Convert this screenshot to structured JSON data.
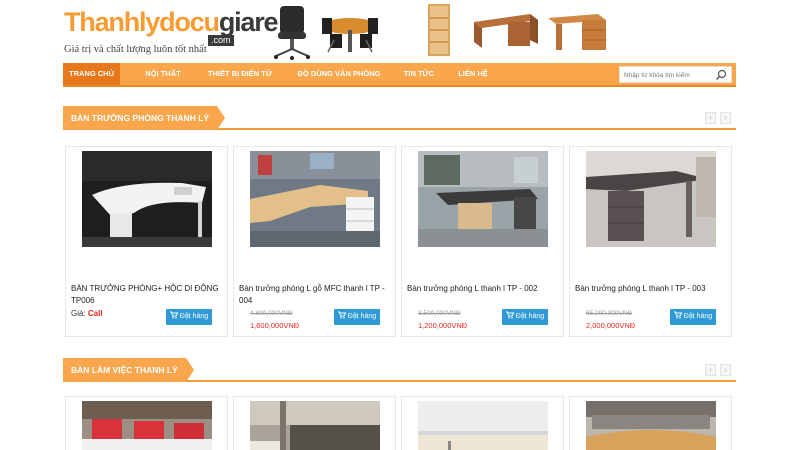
{
  "site": {
    "logo_main_orange": "Thanhlydocu",
    "logo_main_dark": "giare",
    "logo_com": ".com",
    "slogan": "Giá trị và chất lượng luôn tốt nhất"
  },
  "nav": {
    "items": [
      {
        "label": "TRANG CHỦ",
        "active": true
      },
      {
        "label": "NỘI THẤT"
      },
      {
        "label": "THIẾT BỊ ĐIỆN TỬ"
      },
      {
        "label": "ĐỒ DÙNG VĂN PHÒNG"
      },
      {
        "label": "TIN TỨC"
      },
      {
        "label": "LIÊN HỆ"
      }
    ],
    "search_placeholder": "Nhập từ khóa tìm kiếm"
  },
  "sections": [
    {
      "title": "BÀN TRƯỞNG PHÒNG THANH LÝ",
      "products": [
        {
          "name": "BÀN TRƯỞNG PHÒNG+ HỘC DI ĐỘNG TP006",
          "price_label": "Giá:",
          "price_call": "Call"
        },
        {
          "name": "Bàn trưởng phòng L gỗ MFC thanh l  TP - 004",
          "old_price": "4,800,000VNĐ",
          "price": "1,600,000VNĐ"
        },
        {
          "name": "Bàn trưởng phòng L thanh l  TP - 002",
          "old_price": "3,500,000VNĐ",
          "price": "1,200,000VNĐ"
        },
        {
          "name": "Bàn trưởng phòng L thanh l  TP - 003",
          "old_price": "65,000,000VNĐ",
          "price": "2,000,000VNĐ"
        }
      ]
    },
    {
      "title": "BÀN LÀM VIỆC THANH LÝ"
    }
  ],
  "order_button_label": "Đặt hàng",
  "prev_arrow": "‹",
  "next_arrow": "›",
  "colors": {
    "accent": "#f9a64c",
    "accent_dark": "#e7791c",
    "price_red": "#e5281f",
    "button_blue": "#2e9ad6"
  }
}
